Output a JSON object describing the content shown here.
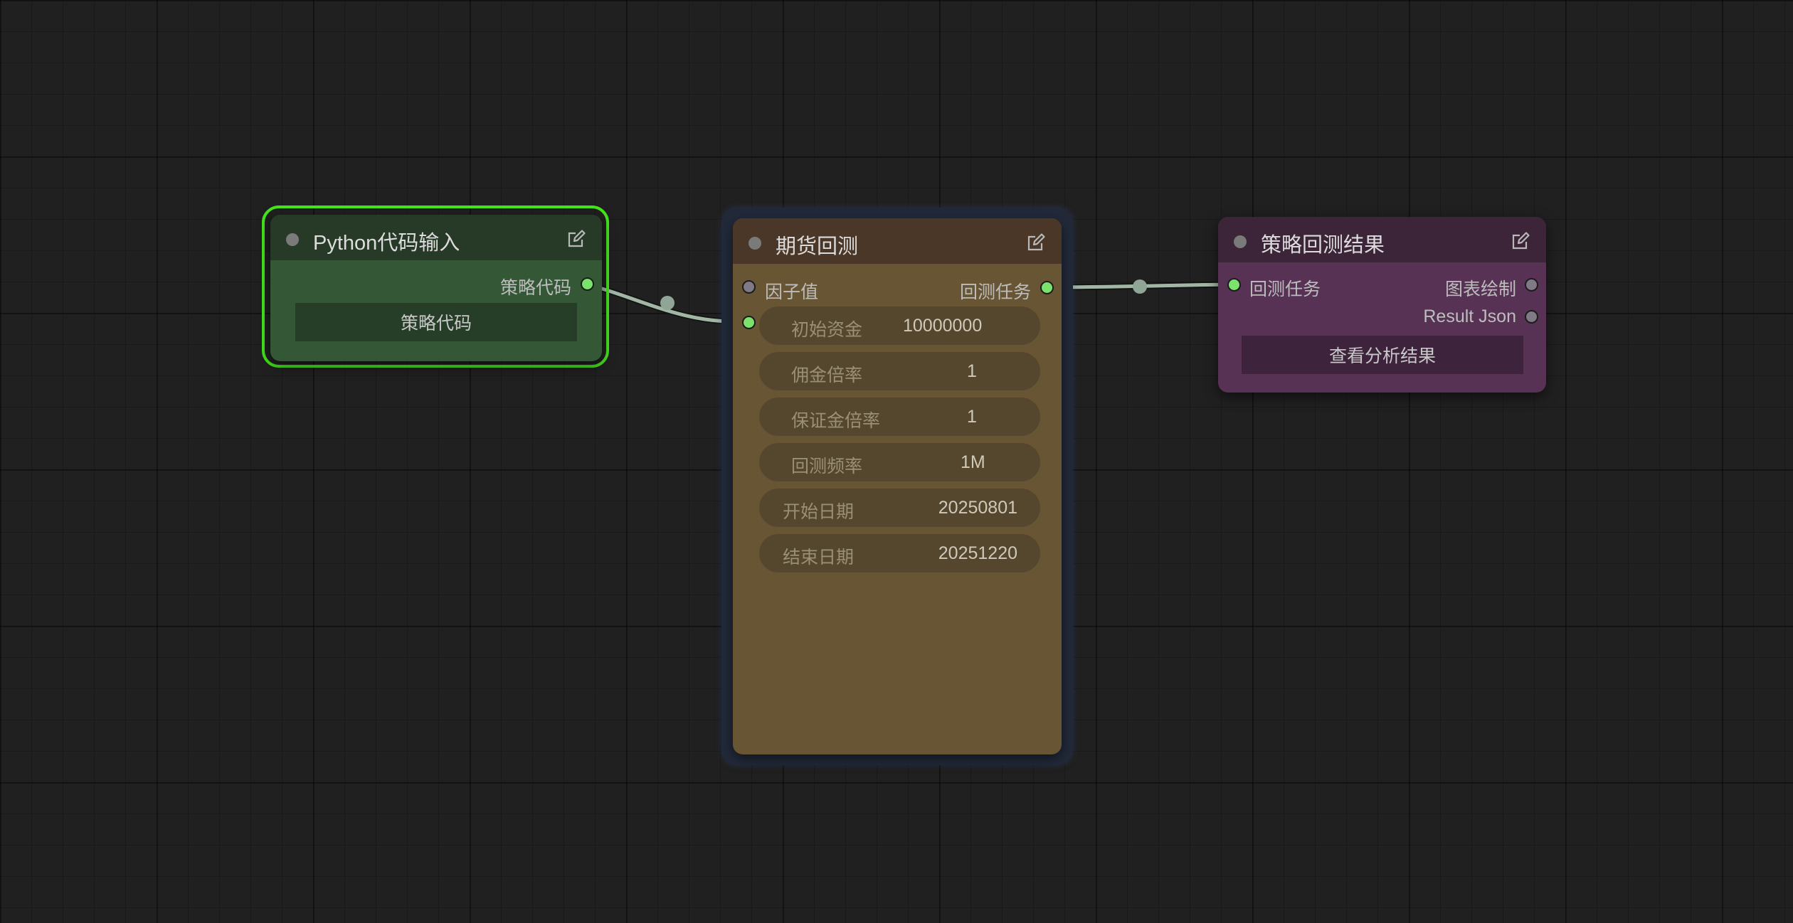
{
  "colors": {
    "canvas_bg": "#202020",
    "port_connected": "#7be36b",
    "port_disconnected": "#7f7a86",
    "selection_outline": "#45e51d",
    "link": "#a2b6a6"
  },
  "nodes": {
    "python_input": {
      "title": "Python代码输入",
      "output_label": "策略代码",
      "widget_button": "策略代码",
      "header_icon": "edit-icon"
    },
    "futures_backtest": {
      "title": "期货回测",
      "inputs": [
        "因子值"
      ],
      "output_label": "回测任务",
      "header_icon": "edit-icon",
      "fields": [
        {
          "label": "初始资金",
          "value": "10000000"
        },
        {
          "label": "佣金倍率",
          "value": "1"
        },
        {
          "label": "保证金倍率",
          "value": "1"
        },
        {
          "label": "回测频率",
          "value": "1M"
        },
        {
          "label": "开始日期",
          "value": "20250801"
        },
        {
          "label": "结束日期",
          "value": "20251220"
        }
      ]
    },
    "strategy_result": {
      "title": "策略回测结果",
      "input_label": "回测任务",
      "outputs": [
        "图表绘制",
        "Result Json"
      ],
      "widget_button": "查看分析结果",
      "header_icon": "edit-icon"
    }
  }
}
